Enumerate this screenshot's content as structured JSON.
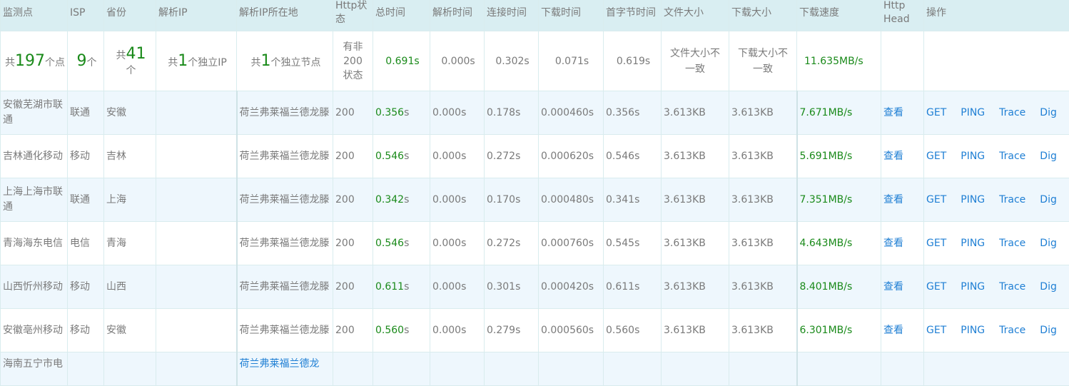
{
  "headers": {
    "monitor": "监测点",
    "isp": "ISP",
    "province": "省份",
    "resolved_ip": "解析IP",
    "ip_location": "解析IP所在地",
    "http_status": "Http状态",
    "total_time": "总时间",
    "resolve_time": "解析时间",
    "connect_time": "连接时间",
    "download_time": "下载时间",
    "first_byte_time": "首字节时间",
    "file_size": "文件大小",
    "download_size": "下载大小",
    "download_speed": "下载速度",
    "http_head": "Http Head",
    "actions": "操作"
  },
  "summary": {
    "points_prefix": "共",
    "points_value": "197",
    "points_suffix": "个点",
    "isp_value": "9",
    "isp_suffix": "个",
    "province_prefix": "共",
    "province_value": "41",
    "province_suffix": "个",
    "ip_prefix": "共",
    "ip_value": "1",
    "ip_suffix": "个独立IP",
    "loc_prefix": "共",
    "loc_value": "1",
    "loc_suffix": "个独立节点",
    "status": "有非200状态",
    "total_value": "0.691",
    "total_unit": "s",
    "resolve": "0.000s",
    "connect": "0.302s",
    "download": "0.071s",
    "first_byte": "0.619s",
    "file_size": "文件大小不一致",
    "download_size": "下载大小不一致",
    "speed": "11.635MB/s"
  },
  "rows": [
    {
      "monitor": "安徽芜湖市联通",
      "isp": "联通",
      "province": "安徽",
      "ip": "",
      "location": "荷兰弗莱福兰德龙滕",
      "status": "200",
      "total_value": "0.356",
      "total_unit": "s",
      "resolve": "0.000s",
      "connect": "0.178s",
      "download": "0.000460s",
      "first_byte": "0.356s",
      "file_size": "3.613KB",
      "download_size": "3.613KB",
      "speed": "7.671MB/s"
    },
    {
      "monitor": "吉林通化移动",
      "isp": "移动",
      "province": "吉林",
      "ip": "",
      "location": "荷兰弗莱福兰德龙滕",
      "status": "200",
      "total_value": "0.546",
      "total_unit": "s",
      "resolve": "0.000s",
      "connect": "0.272s",
      "download": "0.000620s",
      "first_byte": "0.546s",
      "file_size": "3.613KB",
      "download_size": "3.613KB",
      "speed": "5.691MB/s"
    },
    {
      "monitor": "上海上海市联通",
      "isp": "联通",
      "province": "上海",
      "ip": "",
      "location": "荷兰弗莱福兰德龙滕",
      "status": "200",
      "total_value": "0.342",
      "total_unit": "s",
      "resolve": "0.000s",
      "connect": "0.170s",
      "download": "0.000480s",
      "first_byte": "0.341s",
      "file_size": "3.613KB",
      "download_size": "3.613KB",
      "speed": "7.351MB/s"
    },
    {
      "monitor": "青海海东电信",
      "isp": "电信",
      "province": "青海",
      "ip": "",
      "location": "荷兰弗莱福兰德龙滕",
      "status": "200",
      "total_value": "0.546",
      "total_unit": "s",
      "resolve": "0.000s",
      "connect": "0.272s",
      "download": "0.000760s",
      "first_byte": "0.545s",
      "file_size": "3.613KB",
      "download_size": "3.613KB",
      "speed": "4.643MB/s"
    },
    {
      "monitor": "山西忻州移动",
      "isp": "移动",
      "province": "山西",
      "ip": "",
      "location": "荷兰弗莱福兰德龙滕",
      "status": "200",
      "total_value": "0.611",
      "total_unit": "s",
      "resolve": "0.000s",
      "connect": "0.301s",
      "download": "0.000420s",
      "first_byte": "0.611s",
      "file_size": "3.613KB",
      "download_size": "3.613KB",
      "speed": "8.401MB/s"
    },
    {
      "monitor": "安徽亳州移动",
      "isp": "移动",
      "province": "安徽",
      "ip": "",
      "location": "荷兰弗莱福兰德龙滕",
      "status": "200",
      "total_value": "0.560",
      "total_unit": "s",
      "resolve": "0.000s",
      "connect": "0.279s",
      "download": "0.000560s",
      "first_byte": "0.560s",
      "file_size": "3.613KB",
      "download_size": "3.613KB",
      "speed": "6.301MB/s"
    }
  ],
  "partial_row": {
    "monitor": "海南五宁市电",
    "location": "荷兰弗莱福兰德龙"
  },
  "actions": {
    "view": "查看",
    "get": "GET",
    "ping": "PING",
    "trace": "Trace",
    "dig": "Dig"
  },
  "colors": {
    "header_bg": "#d9eef2",
    "odd_row": "#eef7fd",
    "green": "#1a8a1a",
    "link": "#1f7fd4"
  }
}
